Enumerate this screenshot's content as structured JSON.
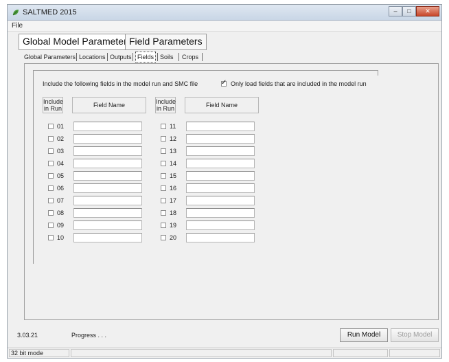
{
  "window": {
    "title": "SALTMED 2015",
    "minimize_glyph": "–",
    "maximize_glyph": "□",
    "close_glyph": "✕",
    "app_icon": "saltmed-leaf-icon"
  },
  "menu": {
    "file": "File"
  },
  "top_tabs": [
    {
      "label": "Global Model Parameters"
    },
    {
      "label": "Field Parameters"
    }
  ],
  "sub_tabs": [
    {
      "label": "Global Parameters"
    },
    {
      "label": "Locations"
    },
    {
      "label": "Outputs"
    },
    {
      "label": "Fields",
      "active": true
    },
    {
      "label": "Soils"
    },
    {
      "label": "Crops"
    }
  ],
  "fields_panel": {
    "instruction": "Include the following fields in the model run and SMC file",
    "only_load_label": "Only load fields that are included in the model run",
    "only_load_checked": true,
    "include_header_line1": "Include",
    "include_header_line2": "in Run",
    "field_name_header": "Field Name",
    "left_rows": [
      "01",
      "02",
      "03",
      "04",
      "05",
      "06",
      "07",
      "08",
      "09",
      "10"
    ],
    "right_rows": [
      "11",
      "12",
      "13",
      "14",
      "15",
      "16",
      "17",
      "18",
      "19",
      "20"
    ]
  },
  "footer": {
    "version": "3.03.21",
    "progress": "Progress . . .",
    "run_button": "Run Model",
    "stop_button": "Stop Model"
  },
  "statusbar": {
    "mode": "32 bit mode"
  }
}
